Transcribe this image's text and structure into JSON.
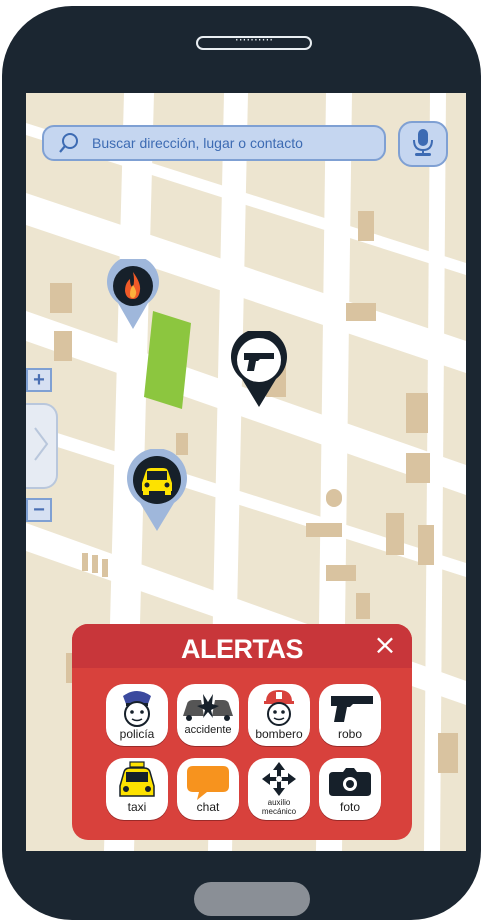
{
  "search": {
    "placeholder": "Buscar dirección, lugar o contacto"
  },
  "alerts": {
    "title": "ALERTAS",
    "close_symbol": "×",
    "buttons": [
      {
        "label": "policía",
        "icon": "police-icon"
      },
      {
        "label": "accidente",
        "icon": "accident-icon"
      },
      {
        "label": "bombero",
        "icon": "firefighter-icon"
      },
      {
        "label": "robo",
        "icon": "gun-icon"
      },
      {
        "label": "taxi",
        "icon": "taxi-icon"
      },
      {
        "label": "chat",
        "icon": "chat-bubble-icon"
      },
      {
        "label": "auxilio mecánico",
        "icon": "wrench-cross-icon"
      },
      {
        "label": "foto",
        "icon": "camera-icon"
      }
    ]
  },
  "map": {
    "zoom_in": "+",
    "zoom_out": "−",
    "markers": [
      {
        "icon": "fire-icon"
      },
      {
        "icon": "gun-icon"
      },
      {
        "icon": "taxi-icon"
      }
    ]
  },
  "colors": {
    "alert_panel": "#d8413c",
    "map_background": "#ede5d0",
    "road": "#ffffff",
    "park": "#8cc63f",
    "building": "#d9c3a0",
    "search_fill": "#c5d6f0",
    "search_text": "#3d6bb3"
  }
}
